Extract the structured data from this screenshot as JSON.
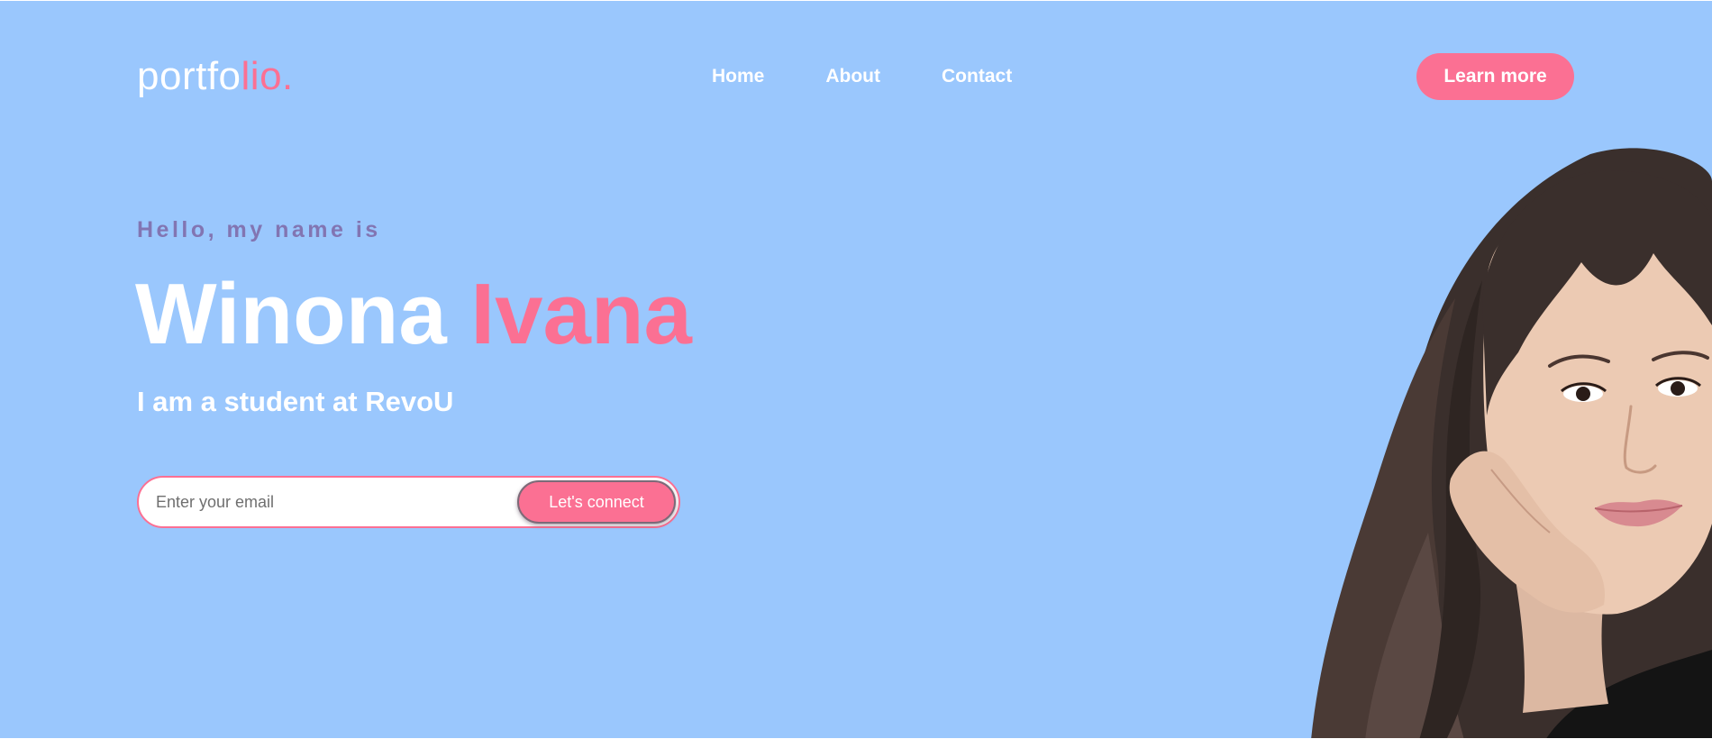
{
  "logo": {
    "main": "portfo",
    "accent": "lio."
  },
  "nav": {
    "items": [
      {
        "label": "Home"
      },
      {
        "label": "About"
      },
      {
        "label": "Contact"
      }
    ]
  },
  "header": {
    "cta_label": "Learn more"
  },
  "hero": {
    "greeting": "Hello, my name is",
    "first_name": "Winona",
    "last_name": "Ivana",
    "subtitle": "I am a student at RevoU"
  },
  "signup": {
    "email_placeholder": "Enter your email",
    "email_value": "",
    "button_label": "Let's connect"
  },
  "colors": {
    "background": "#9ac7fd",
    "accent": "#fb7093",
    "greeting": "#8275b2",
    "text": "#ffffff"
  }
}
